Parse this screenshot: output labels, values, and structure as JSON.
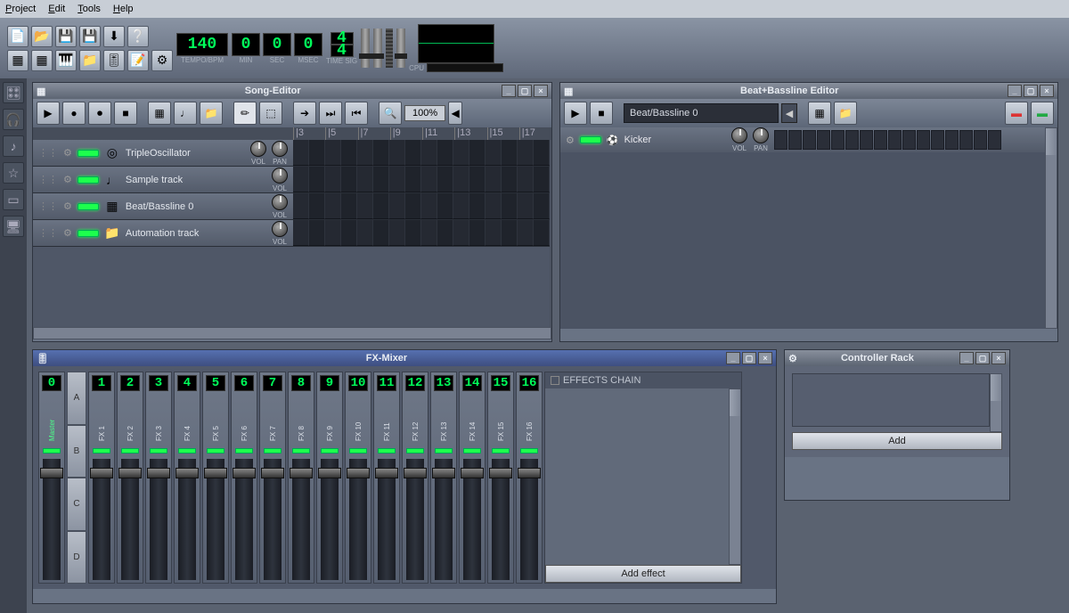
{
  "menu": {
    "project": "Project",
    "edit": "Edit",
    "tools": "Tools",
    "help": "Help"
  },
  "tempo": {
    "bpm": "140",
    "label": "TEMPO/BPM",
    "min": "0",
    "sec": "0",
    "msec": "0",
    "minlbl": "MIN",
    "seclbl": "SEC",
    "mseclbl": "MSEC"
  },
  "timesig": {
    "num": "4",
    "den": "4",
    "label": "TIME SIG"
  },
  "cpu": {
    "label": "CPU"
  },
  "songEditor": {
    "title": "Song-Editor",
    "zoom": "100%",
    "rulerTicks": [
      "|3",
      "|5",
      "|7",
      "|9",
      "|11",
      "|13",
      "|15",
      "|17"
    ],
    "vol": "VOL",
    "pan": "PAN",
    "tracks": [
      {
        "name": "TripleOscillator",
        "icon": "◎",
        "hasPan": true
      },
      {
        "name": "Sample track",
        "icon": "♩",
        "hasPan": false
      },
      {
        "name": "Beat/Bassline 0",
        "icon": "▦",
        "hasPan": false
      },
      {
        "name": "Automation track",
        "icon": "📁",
        "hasPan": false
      }
    ]
  },
  "bbEditor": {
    "title": "Beat+Bassline Editor",
    "selected": "Beat/Bassline 0",
    "vol": "VOL",
    "pan": "PAN",
    "track": {
      "name": "Kicker",
      "icon": "⚽"
    }
  },
  "mixer": {
    "title": "FX-Mixer",
    "master": {
      "num": "0",
      "name": "Master"
    },
    "sendLabels": [
      "A",
      "B",
      "C",
      "D"
    ],
    "channels": [
      {
        "num": "1",
        "name": "FX 1"
      },
      {
        "num": "2",
        "name": "FX 2"
      },
      {
        "num": "3",
        "name": "FX 3"
      },
      {
        "num": "4",
        "name": "FX 4"
      },
      {
        "num": "5",
        "name": "FX 5"
      },
      {
        "num": "6",
        "name": "FX 6"
      },
      {
        "num": "7",
        "name": "FX 7"
      },
      {
        "num": "8",
        "name": "FX 8"
      },
      {
        "num": "9",
        "name": "FX 9"
      },
      {
        "num": "10",
        "name": "FX 10"
      },
      {
        "num": "11",
        "name": "FX 11"
      },
      {
        "num": "12",
        "name": "FX 12"
      },
      {
        "num": "13",
        "name": "FX 13"
      },
      {
        "num": "14",
        "name": "FX 14"
      },
      {
        "num": "15",
        "name": "FX 15"
      },
      {
        "num": "16",
        "name": "FX 16"
      }
    ],
    "effectsChain": "EFFECTS CHAIN",
    "addEffect": "Add effect"
  },
  "controller": {
    "title": "Controller Rack",
    "add": "Add"
  }
}
